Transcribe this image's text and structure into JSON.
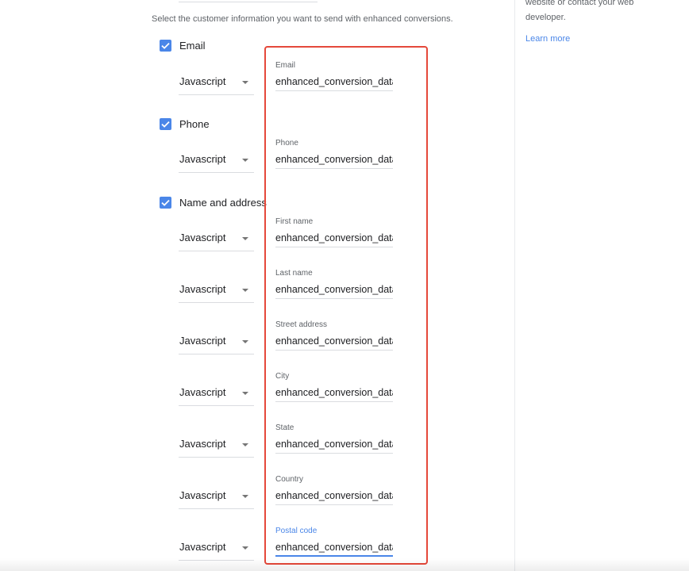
{
  "intro_text": "Select the customer information you want to send with enhanced conversions.",
  "sidebar": {
    "help_text": "website or contact your web developer.",
    "learn_more": "Learn more"
  },
  "groups": {
    "email": {
      "label": "Email",
      "checked": true
    },
    "phone": {
      "label": "Phone",
      "checked": true
    },
    "name_address": {
      "label": "Name and address",
      "checked": true
    }
  },
  "rows": [
    {
      "method": "Javascript",
      "field_label": "Email",
      "field_value": "enhanced_conversion_data"
    },
    {
      "method": "Javascript",
      "field_label": "Phone",
      "field_value": "enhanced_conversion_data"
    },
    {
      "method": "Javascript",
      "field_label": "First name",
      "field_value": "enhanced_conversion_data"
    },
    {
      "method": "Javascript",
      "field_label": "Last name",
      "field_value": "enhanced_conversion_data"
    },
    {
      "method": "Javascript",
      "field_label": "Street address",
      "field_value": "enhanced_conversion_data"
    },
    {
      "method": "Javascript",
      "field_label": "City",
      "field_value": "enhanced_conversion_data"
    },
    {
      "method": "Javascript",
      "field_label": "State",
      "field_value": "enhanced_conversion_data"
    },
    {
      "method": "Javascript",
      "field_label": "Country",
      "field_value": "enhanced_conversion_data"
    },
    {
      "method": "Javascript",
      "field_label": "Postal code",
      "field_value": "enhanced_conversion_data"
    }
  ],
  "colors": {
    "accent": "#4a86e8",
    "highlight": "#e5483a"
  }
}
